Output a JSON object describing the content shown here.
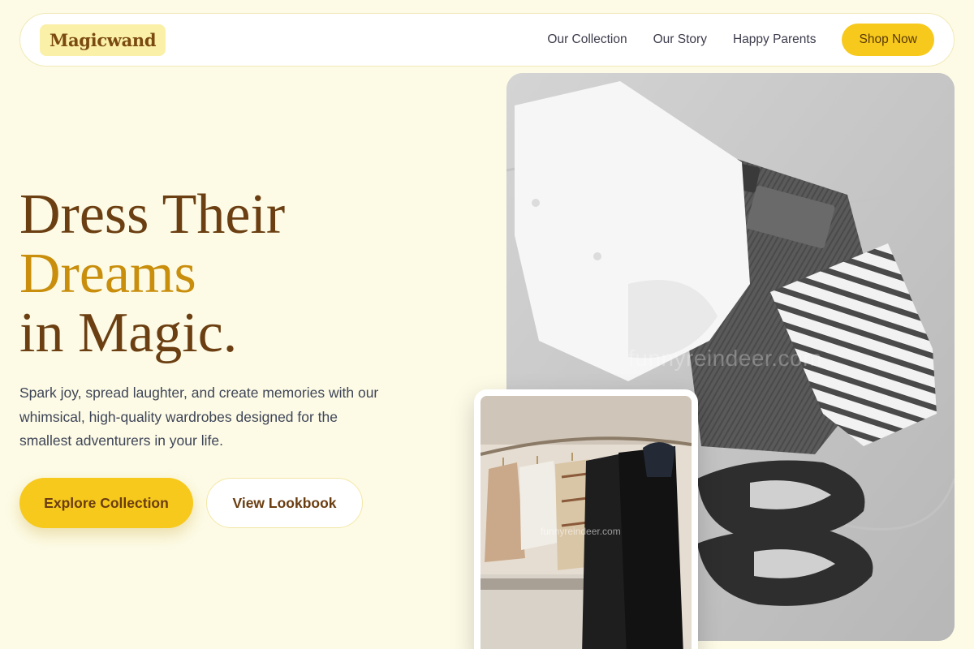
{
  "nav": {
    "logo": "Magicwand",
    "links": [
      "Our Collection",
      "Our Story",
      "Happy Parents"
    ],
    "cta": "Shop Now"
  },
  "hero": {
    "headline_line1": "Dress Their",
    "headline_accent": "Dreams",
    "headline_line3": "in Magic.",
    "subtext": "Spark joy, spread laughter, and create memories with our whimsical, high-quality wardrobes designed for the smallest adventurers in your life.",
    "primary_button": "Explore Collection",
    "secondary_button": "View Lookbook"
  },
  "images": {
    "main_watermark": "funnyreindeer.com",
    "small_watermark": "funnyreindeer.com"
  },
  "colors": {
    "background": "#fdfbe6",
    "accent_yellow": "#f7c91c",
    "brown": "#6b3f12",
    "gold": "#c98e0c"
  }
}
